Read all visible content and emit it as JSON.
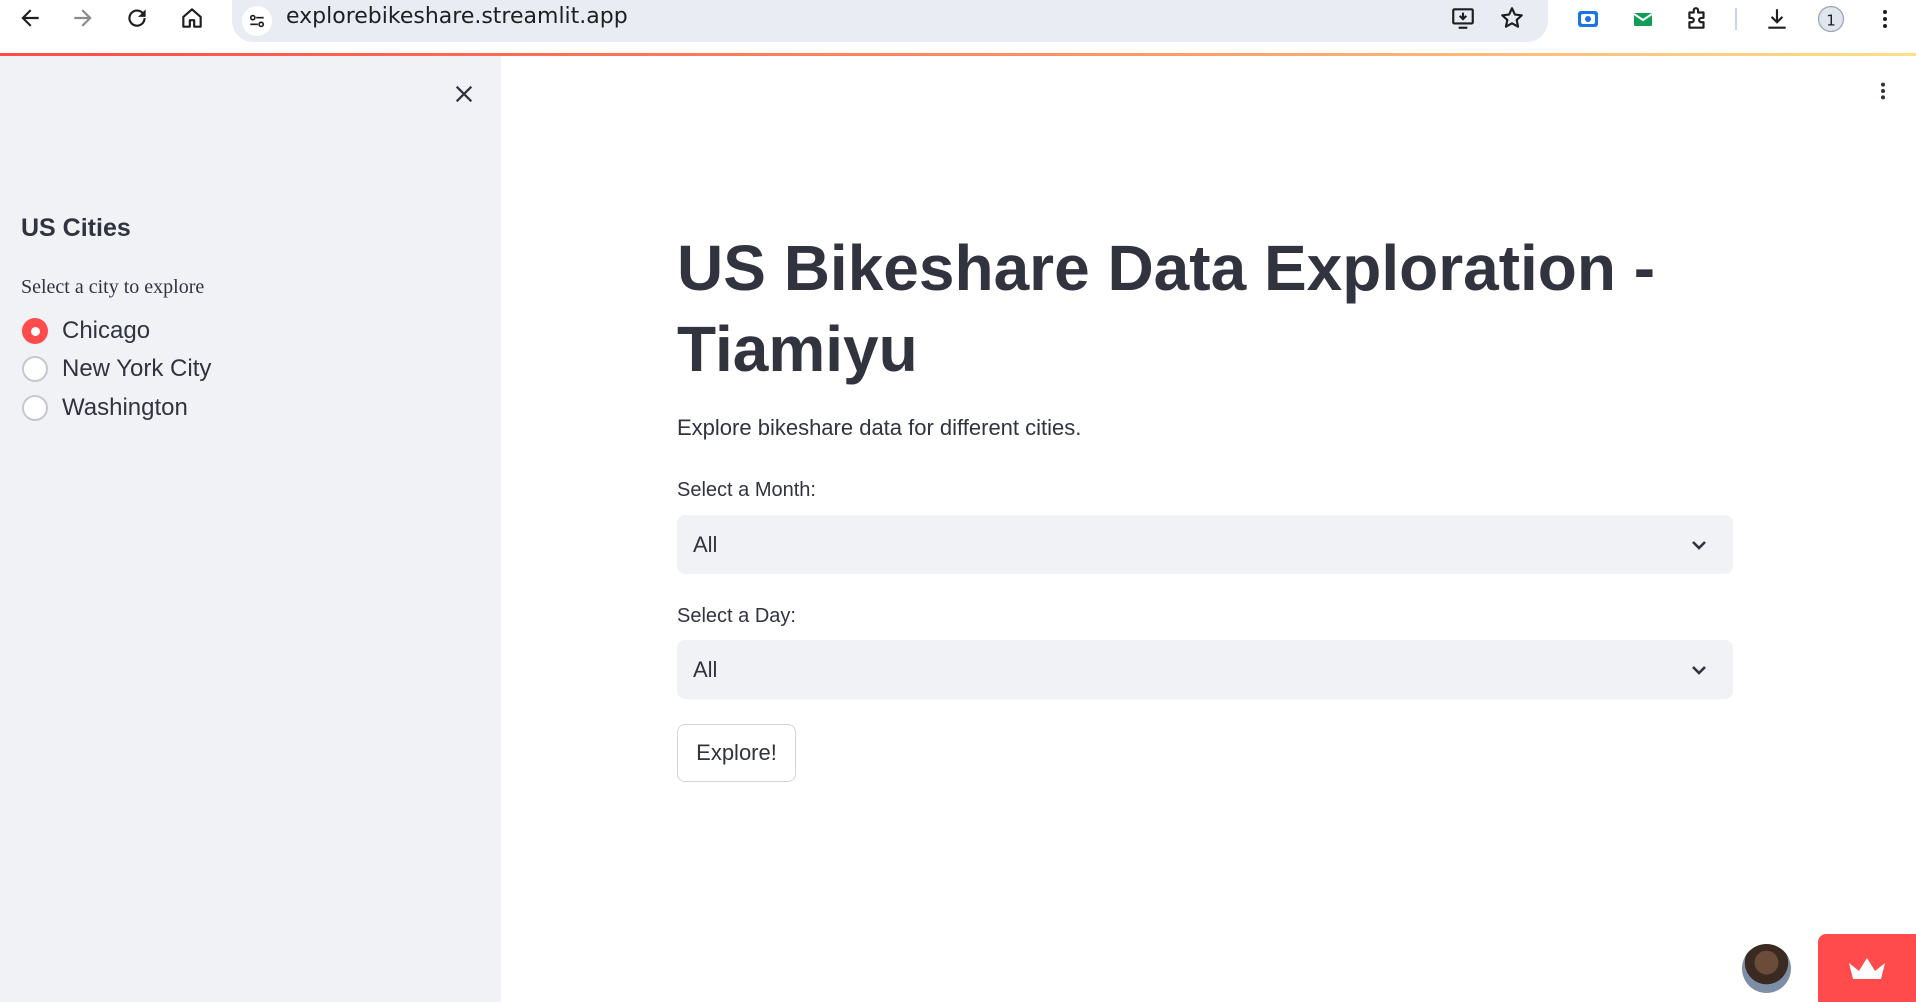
{
  "browser": {
    "url": "explorebikeshare.streamlit.app"
  },
  "sidebar": {
    "heading": "US Cities",
    "radio_label": "Select a city to explore",
    "options": [
      {
        "label": "Chicago",
        "selected": true
      },
      {
        "label": "New York City",
        "selected": false
      },
      {
        "label": "Washington",
        "selected": false
      }
    ]
  },
  "main": {
    "title": "US Bikeshare Data Exploration - Tiamiyu",
    "subtitle": "Explore bikeshare data for different cities.",
    "month_label": "Select a Month:",
    "month_value": "All",
    "day_label": "Select a Day:",
    "day_value": "All",
    "explore_button": "Explore!"
  },
  "colors": {
    "accent": "#ff4b4b",
    "sidebar_bg": "#f0f2f6",
    "text": "#31333f"
  },
  "icons": [
    "back-arrow-icon",
    "forward-arrow-icon",
    "reload-icon",
    "home-icon",
    "site-settings-icon",
    "install-app-icon",
    "bookmark-star-icon",
    "extension-icon",
    "download-icon",
    "chrome-menu-icon",
    "close-icon",
    "kebab-menu-icon",
    "chevron-down-icon",
    "streamlit-crown-icon"
  ]
}
